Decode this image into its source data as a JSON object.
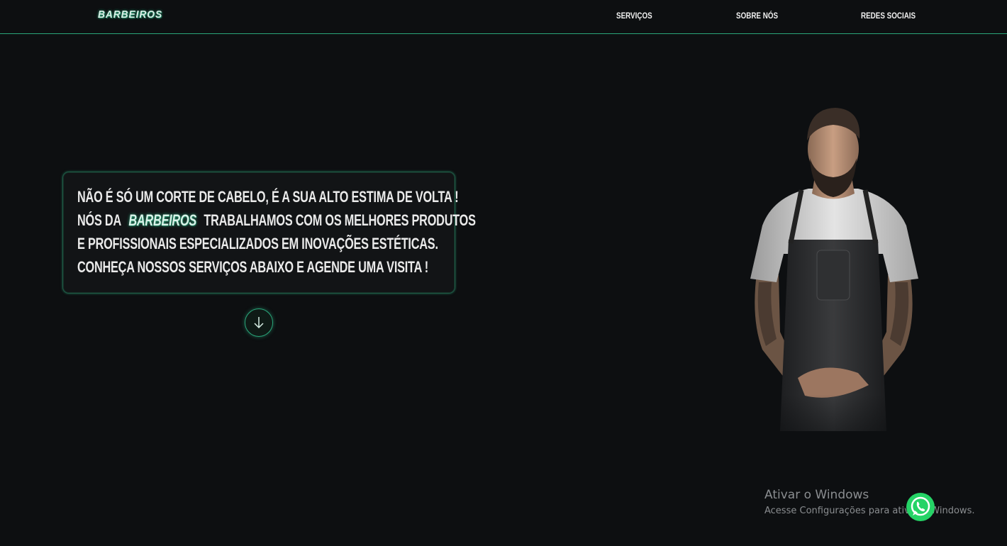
{
  "navbar": {
    "logo": "BARBEIROS",
    "links": [
      {
        "label": "SERVIÇOS"
      },
      {
        "label": "SOBRE NÓS"
      },
      {
        "label": "REDES SOCIAIS"
      }
    ]
  },
  "hero": {
    "line1": "NÃO É SÓ UM CORTE DE CABELO, É A SUA ALTO ESTIMA DE VOLTA !",
    "line2_before": "NÓS DA",
    "line2_brand": "BARBEIROS",
    "line2_after": "TRABALHAMOS COM OS MELHORES PRODUTOS",
    "line3": "E PROFISSIONAIS ESPECIALIZADOS EM INOVAÇÕES ESTÉTICAS.",
    "line4": "CONHEÇA NOSSOS SERVIÇOS ABAIXO E AGENDE UMA VISITA !"
  },
  "icons": {
    "scroll": "arrow-down-icon",
    "whatsapp": "whatsapp-icon"
  },
  "watermark": {
    "title": "Ativar o Windows",
    "subtitle": "Acesse Configurações para ativar o Windows."
  },
  "colors": {
    "background": "#0d0f11",
    "accent": "#2aa57a",
    "whatsapp": "#25d366"
  }
}
